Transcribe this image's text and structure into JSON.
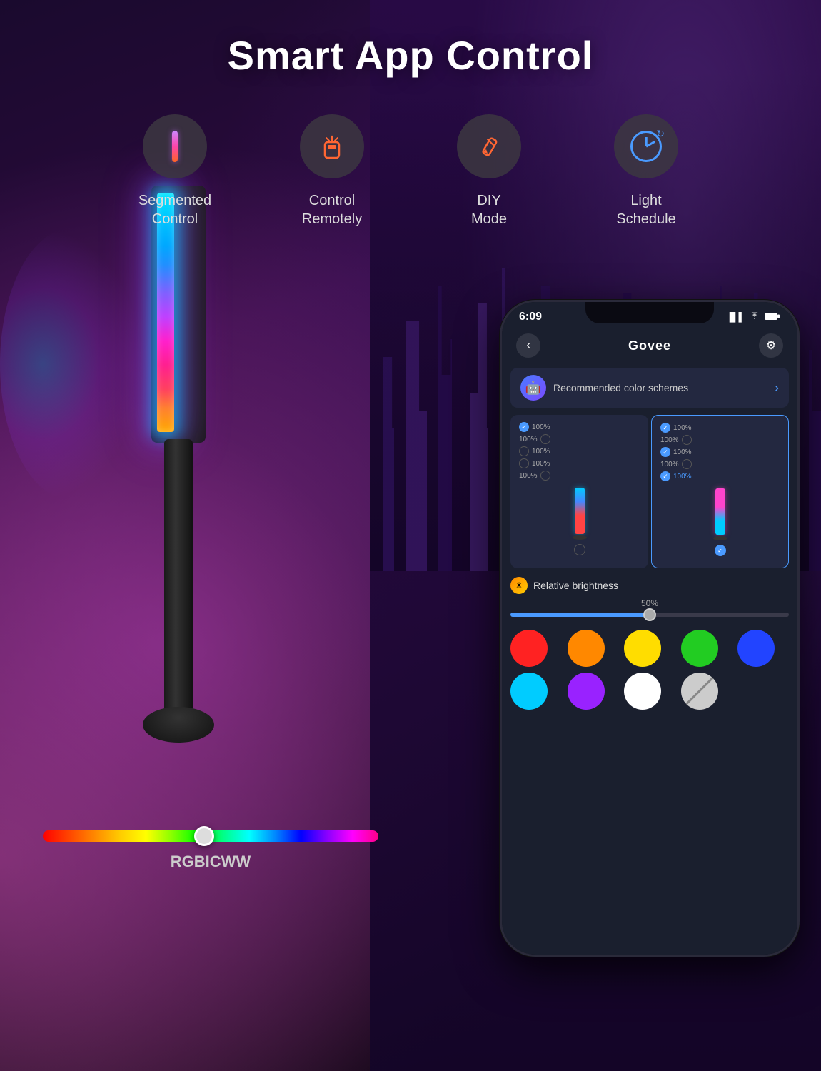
{
  "page": {
    "title": "Smart App Control",
    "background_colors": {
      "main": "#1a0a2e",
      "accent_purple": "#8b00ff",
      "accent_pink": "#cc44aa"
    }
  },
  "features": [
    {
      "id": "segmented-control",
      "label": "Segmented\nControl",
      "label_line1": "Segmented",
      "label_line2": "Control",
      "icon": "seg-bar-icon"
    },
    {
      "id": "control-remotely",
      "label": "Control\nRemotely",
      "label_line1": "Control",
      "label_line2": "Remotely",
      "icon": "remote-icon"
    },
    {
      "id": "diy-mode",
      "label": "DIY\nMode",
      "label_line1": "DIY",
      "label_line2": "Mode",
      "icon": "diy-icon"
    },
    {
      "id": "light-schedule",
      "label": "Light\nSchedule",
      "label_line1": "Light",
      "label_line2": "Schedule",
      "icon": "clock-icon"
    }
  ],
  "slider": {
    "label": "RGBICWW",
    "value": 48
  },
  "phone": {
    "status_bar": {
      "time": "6:09",
      "signal": "▐▌",
      "wifi": "wifi",
      "battery": "battery"
    },
    "header": {
      "back_label": "‹",
      "title": "Govee",
      "settings_icon": "⚙"
    },
    "recommended_banner": {
      "text": "Recommended color schemes",
      "arrow": "›"
    },
    "left_panel": {
      "rows": [
        {
          "check": true,
          "pct": "100%",
          "color": "#00ccff"
        },
        {
          "check": false,
          "pct": "100%",
          "color": "#ff4444"
        },
        {
          "check": false,
          "pct": "100%",
          "color": "#ff4444"
        },
        {
          "check": false,
          "pct": "100%",
          "color": "#cc44ff"
        },
        {
          "check": false,
          "pct": "100%",
          "color": "#cc44ff"
        }
      ],
      "bar_color_top": "#00ccff",
      "bar_color_bottom": "#ff4444"
    },
    "right_panel": {
      "rows": [
        {
          "check": true,
          "pct": "100%",
          "color": "#ff44cc"
        },
        {
          "check": false,
          "pct": "100%",
          "color": "#ff44cc"
        },
        {
          "check": true,
          "pct": "100%",
          "color": "#00ccff"
        },
        {
          "check": false,
          "pct": "100%",
          "color": "#4a9aff"
        },
        {
          "check": true,
          "pct": "100%",
          "color": "#4a9aff"
        }
      ],
      "bar_color_top": "#ff44cc",
      "bar_color_bottom": "#00ccff",
      "active": true
    },
    "brightness": {
      "title": "Relative brightness",
      "percent": "50%",
      "value": 50
    },
    "color_swatches": [
      {
        "color": "#ff2222",
        "row": 1
      },
      {
        "color": "#ff8800",
        "row": 1
      },
      {
        "color": "#ffdd00",
        "row": 1
      },
      {
        "color": "#22cc22",
        "row": 1
      },
      {
        "color": "#2244ff",
        "row": 1
      },
      {
        "color": "#00ccff",
        "row": 2
      },
      {
        "color": "#9922ff",
        "row": 2
      },
      {
        "color": "#ffffff",
        "row": 2
      },
      {
        "color": "strikethrough",
        "row": 2
      },
      {
        "color": "none",
        "row": 2
      }
    ]
  }
}
